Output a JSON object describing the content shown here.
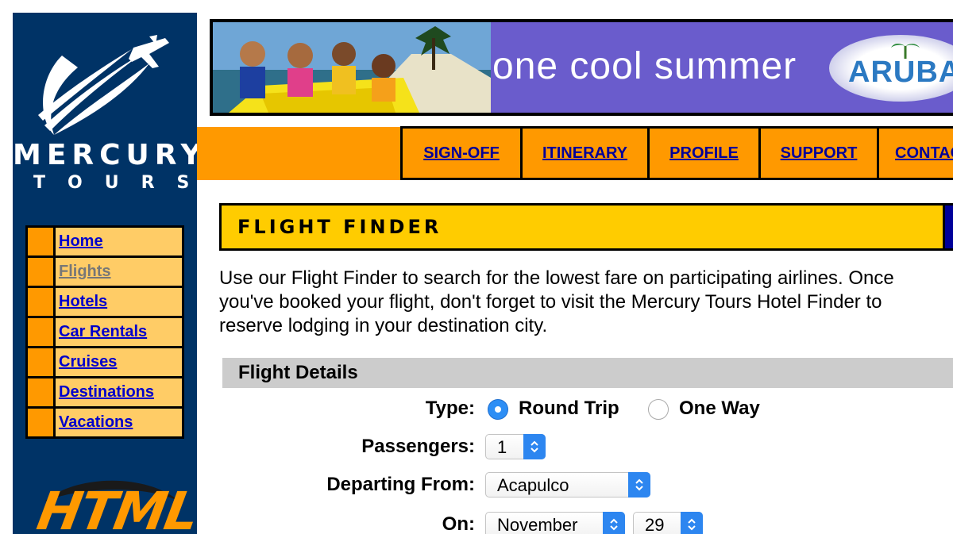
{
  "brand": {
    "name_line1": "MERCURY",
    "name_line2": "TOURS"
  },
  "sidebar": {
    "items": [
      {
        "label": "Home"
      },
      {
        "label": "Flights"
      },
      {
        "label": "Hotels"
      },
      {
        "label": "Car Rentals"
      },
      {
        "label": "Cruises"
      },
      {
        "label": "Destinations"
      },
      {
        "label": "Vacations"
      }
    ],
    "badge_text": "HTML"
  },
  "banner": {
    "slogan": "one cool summer",
    "logo_text": "ARUBA"
  },
  "top_nav": {
    "items": [
      {
        "label": "SIGN-OFF"
      },
      {
        "label": "ITINERARY"
      },
      {
        "label": "PROFILE"
      },
      {
        "label": "SUPPORT"
      },
      {
        "label": "CONTACT"
      }
    ]
  },
  "flight_finder": {
    "title": "FLIGHT FINDER",
    "intro_line1": "Use our Flight Finder to search for the lowest fare on participating airlines. Once",
    "intro_line2": "you've booked your flight, don't forget to visit the Mercury Tours Hotel Finder to",
    "intro_line3": "reserve lodging in your destination city.",
    "section_title": "Flight Details",
    "type_label": "Type:",
    "type_options": [
      {
        "label": "Round Trip",
        "checked": true
      },
      {
        "label": "One Way",
        "checked": false
      }
    ],
    "passengers_label": "Passengers:",
    "passengers_value": "1",
    "departing_label": "Departing From:",
    "departing_value": "Acapulco",
    "on_label": "On:",
    "on_month": "November",
    "on_day": "29"
  },
  "colors": {
    "sidebar_bg": "#003366",
    "orange": "#ff9900",
    "nav_cell": "#ffcc66",
    "header_yellow": "#ffcc00",
    "link_blue": "#0000cc",
    "select_blue": "#2d86f0"
  }
}
